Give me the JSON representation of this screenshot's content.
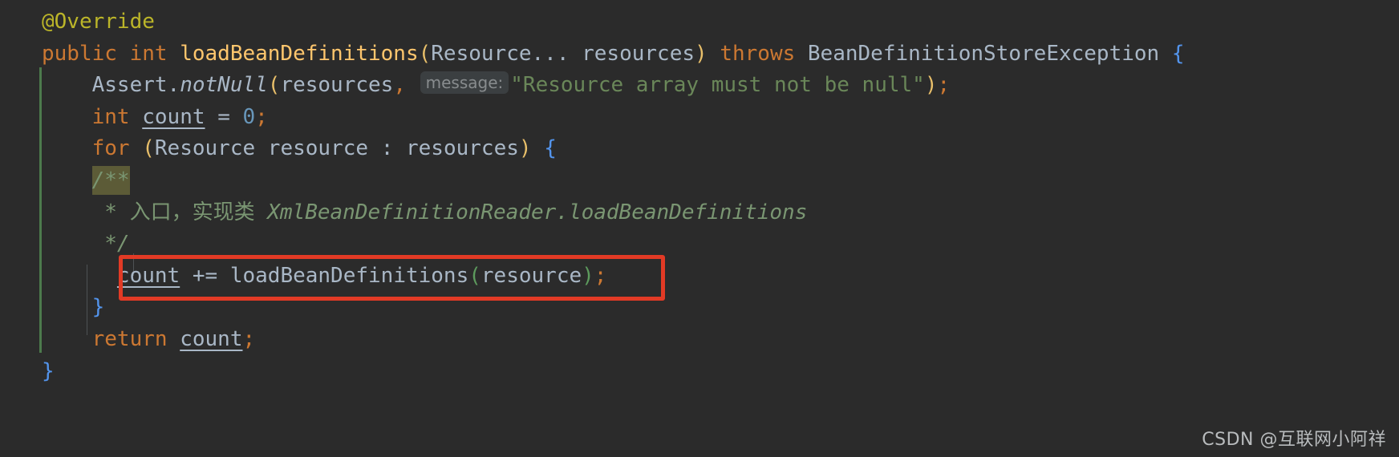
{
  "editor": {
    "background_color": "#2B2B2B",
    "default_text_color": "#A9B7C6",
    "language": "java"
  },
  "vcs_marker": {
    "name": "modified-lines-marker",
    "color": "#4C7A4C"
  },
  "annotation": {
    "type": "rectangle",
    "color": "#E23A25",
    "target_line": 9,
    "target_text": "count += loadBeanDefinitions(resource);"
  },
  "param_hint": {
    "label": "message:",
    "background_color": "#3B3F41",
    "text_color": "#888C8E"
  },
  "selection_highlight": {
    "text": "/**",
    "color": "#5C5B37"
  },
  "watermark": {
    "text": "CSDN @互联网小阿祥",
    "color": "#C9CCCE"
  },
  "code": {
    "line1": {
      "annotation": "@Override"
    },
    "line2": {
      "kw_public": "public",
      "kw_int": "int",
      "method": "loadBeanDefinitions",
      "paren_open": "(",
      "type_resource": "Resource...",
      "param_resources": "resources",
      "paren_close": ")",
      "kw_throws": "throws",
      "exception_type": "BeanDefinitionStoreException",
      "brace_open": "{"
    },
    "line3": {
      "class_assert": "Assert",
      "dot": ".",
      "method_notnull": "notNull",
      "paren_open": "(",
      "arg_resources": "resources",
      "comma": ",",
      "hint": "message:",
      "string": "\"Resource array must not be null\"",
      "paren_close": ")",
      "semi": ";"
    },
    "line4": {
      "kw_int": "int",
      "var_count": "count",
      "equals": "=",
      "number_zero": "0",
      "semi": ";"
    },
    "line5": {
      "kw_for": "for",
      "paren_open": "(",
      "type_resource": "Resource",
      "var_resource": "resource",
      "colon": ":",
      "var_resources": "resources",
      "paren_close": ")",
      "brace_open": "{"
    },
    "line6": {
      "comment_open": "/**"
    },
    "line7": {
      "star": "*",
      "text_cn": "入口，实现类",
      "ref": "XmlBeanDefinitionReader.loadBeanDefinitions"
    },
    "line8": {
      "comment_close": "*/"
    },
    "line9": {
      "var_count": "count",
      "op_plus_equals": "+=",
      "method": "loadBeanDefinitions",
      "paren_open": "(",
      "arg_resource": "resource",
      "paren_close": ")",
      "semi": ";"
    },
    "line10": {
      "brace_close": "}"
    },
    "line11": {
      "kw_return": "return",
      "var_count": "count",
      "semi": ";"
    },
    "line12": {
      "brace_close": "}"
    }
  }
}
